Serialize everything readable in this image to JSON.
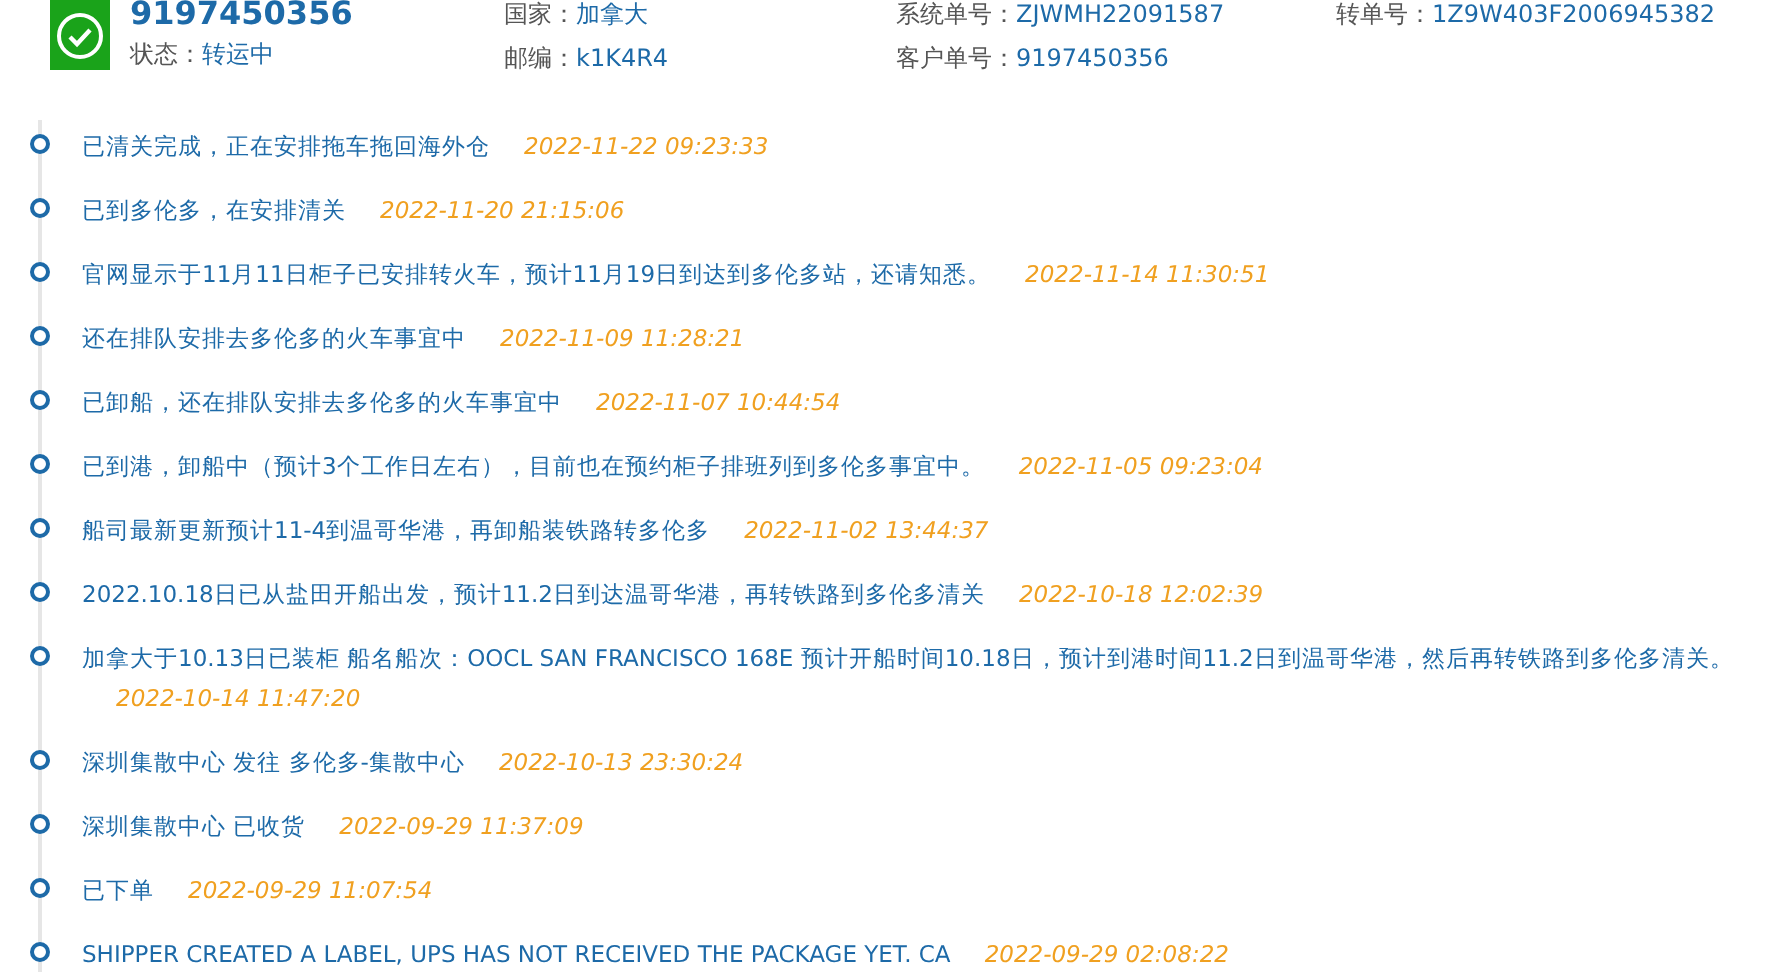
{
  "header": {
    "tracking_number": "9197450356",
    "status_label": "状态：",
    "status": "转运中",
    "fields": [
      {
        "label": "国家：",
        "value": "加拿大"
      },
      {
        "label": "系统单号：",
        "value": "ZJWMH22091587"
      },
      {
        "label": "转单号：",
        "value": "1Z9W403F2006945382"
      },
      {
        "label": "邮编：",
        "value": "k1K4R4"
      },
      {
        "label": "客户单号：",
        "value": "9197450356"
      }
    ]
  },
  "events": [
    {
      "text": "已清关完成，正在安排拖车拖回海外仓",
      "time": "2022-11-22 09:23:33"
    },
    {
      "text": "已到多伦多，在安排清关",
      "time": "2022-11-20 21:15:06"
    },
    {
      "text": "官网显示于11月11日柜子已安排转火车，预计11月19日到达到多伦多站，还请知悉。",
      "time": "2022-11-14 11:30:51"
    },
    {
      "text": "还在排队安排去多伦多的火车事宜中",
      "time": "2022-11-09 11:28:21"
    },
    {
      "text": "已卸船，还在排队安排去多伦多的火车事宜中",
      "time": "2022-11-07 10:44:54"
    },
    {
      "text": "已到港，卸船中（预计3个工作日左右），目前也在预约柜子排班列到多伦多事宜中。",
      "time": "2022-11-05 09:23:04"
    },
    {
      "text": "船司最新更新预计11-4到温哥华港，再卸船装铁路转多伦多",
      "time": "2022-11-02 13:44:37"
    },
    {
      "text": "2022.10.18日已从盐田开船出发，预计11.2日到达温哥华港，再转铁路到多伦多清关",
      "time": "2022-10-18 12:02:39"
    },
    {
      "text": "加拿大于10.13日已装柜 船名船次：OOCL SAN FRANCISCO 168E 预计开船时间10.18日，预计到港时间11.2日到温哥华港，然后再转铁路到多伦多清关。",
      "time": "2022-10-14 11:47:20"
    },
    {
      "text": "深圳集散中心 发往 多伦多-集散中心",
      "time": "2022-10-13 23:30:24"
    },
    {
      "text": "深圳集散中心 已收货",
      "time": "2022-09-29 11:37:09"
    },
    {
      "text": "已下单",
      "time": "2022-09-29 11:07:54"
    },
    {
      "text": "SHIPPER CREATED A LABEL, UPS HAS NOT RECEIVED THE PACKAGE YET. CA",
      "time": "2022-09-29 02:08:22"
    }
  ]
}
